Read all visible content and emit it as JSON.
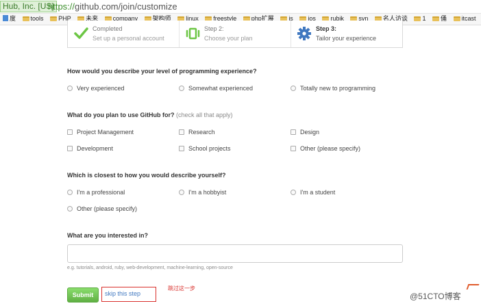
{
  "browser": {
    "cert_label": "Hub, Inc. [US]",
    "url_scheme": "https://",
    "url_rest": "github.com/join/customize",
    "bookmarks": [
      "度",
      "tools",
      "PHP",
      "未来",
      "company",
      "架构师",
      "linux",
      "freestyle",
      "php扩展",
      "js",
      "ios",
      "rubik",
      "svn",
      "名人访谈",
      "1",
      "俑",
      "itcast"
    ]
  },
  "steps": [
    {
      "title": "Completed",
      "desc": "Set up a personal account",
      "state": "done",
      "icon": "checkmark-icon",
      "color": "#6cc644"
    },
    {
      "title": "Step 2:",
      "desc": "Choose your plan",
      "state": "done",
      "icon": "plan-icon",
      "color": "#6cc644"
    },
    {
      "title": "Step 3:",
      "desc": "Tailor your experience",
      "state": "active",
      "icon": "gear-icon",
      "color": "#4078c0"
    }
  ],
  "q1": {
    "question": "How would you describe your level of programming experience?",
    "options": [
      "Very experienced",
      "Somewhat experienced",
      "Totally new to programming"
    ]
  },
  "q2": {
    "question": "What do you plan to use GitHub for?",
    "hint": "(check all that apply)",
    "options": [
      "Project Management",
      "Research",
      "Design",
      "Development",
      "School projects",
      "Other (please specify)"
    ]
  },
  "q3": {
    "question": "Which is closest to how you would describe yourself?",
    "options": [
      "I'm a professional",
      "I'm a hobbyist",
      "I'm a student",
      "Other (please specify)"
    ]
  },
  "q4": {
    "question": "What are you interested in?",
    "value": "",
    "hint": "e.g. tutorials, android, ruby, web-development, machine-learning, open-source"
  },
  "actions": {
    "submit": "Submit",
    "skip": "skip this step",
    "note": "跳过这一步"
  },
  "watermark": "@51CTO博客",
  "colors": {
    "accent_green": "#6cc644",
    "link_blue": "#4078c0",
    "annotation_red": "#d9302c"
  }
}
